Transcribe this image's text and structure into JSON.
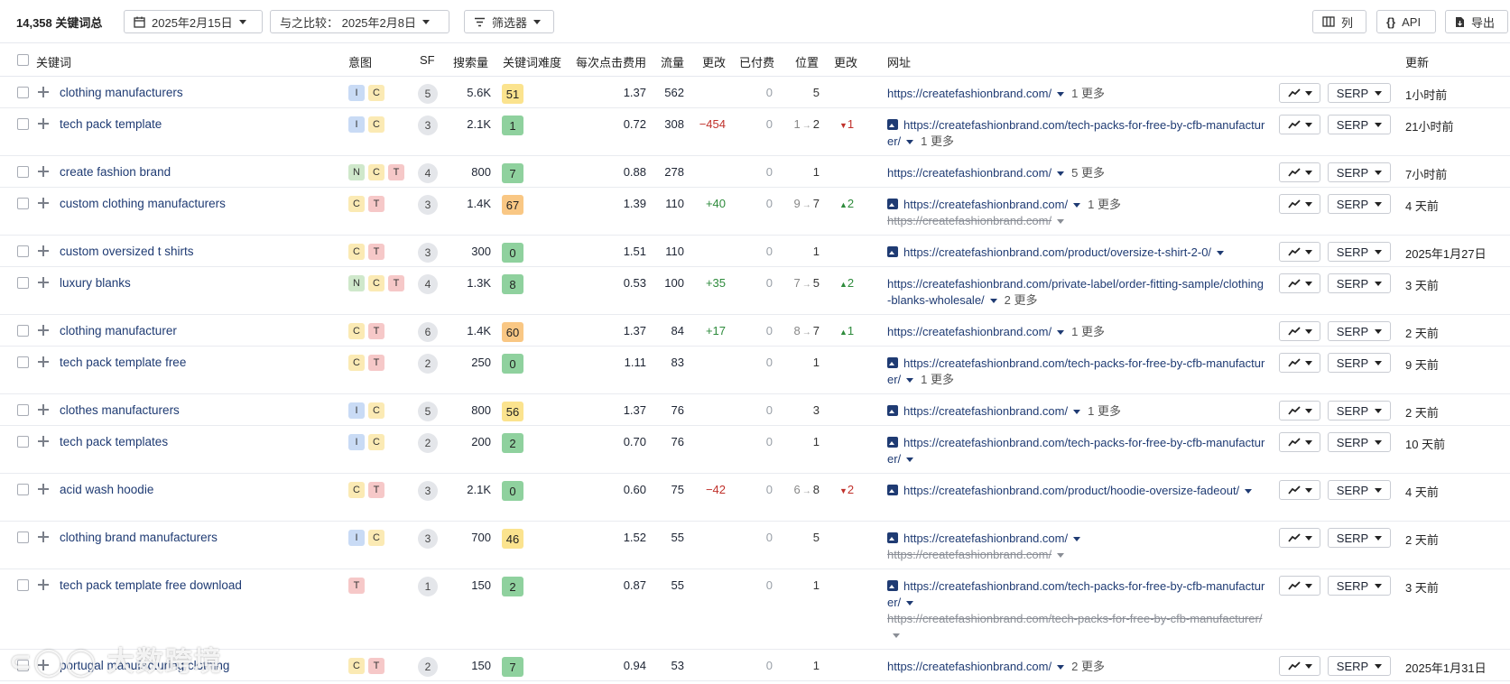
{
  "toolbar": {
    "count": "14,358 关键词总",
    "date": "2025年2月15日",
    "compare": "与之比较： 2025年2月8日",
    "filter": "筛选器",
    "columns": "列",
    "api": "API",
    "export": "导出"
  },
  "header": {
    "keyword": "关键词",
    "intent": "意图",
    "sf": "SF",
    "volume": "搜索量",
    "kd": "关键词难度",
    "cpc": "每次点击费用",
    "traffic": "流量",
    "change": "更改",
    "paid": "已付费",
    "position": "位置",
    "pos_change": "更改",
    "url": "网址",
    "updated": "更新"
  },
  "colors": {
    "kd_green": "#8fd19e",
    "kd_yellow": "#fbe38e",
    "kd_orange": "#f9c784",
    "positive": "#2e8b3c",
    "negative": "#c0312b"
  },
  "buttons": {
    "serp": "SERP"
  },
  "rows": [
    {
      "keyword": "clothing manufacturers",
      "intents": [
        "I",
        "C"
      ],
      "sf": "5",
      "volume": "5.6K",
      "kd": "51",
      "kd_color": "#fbe38e",
      "cpc": "1.37",
      "traffic": "562",
      "change": "",
      "paid": "0",
      "pos_from": "",
      "pos": "5",
      "pos_change": "",
      "pos_dir": "",
      "url_icon": false,
      "url": "https://createfashionbrand.com/",
      "more": "1 更多",
      "old_url": "",
      "updated": "1小时前"
    },
    {
      "keyword": "tech pack template",
      "intents": [
        "I",
        "C"
      ],
      "sf": "3",
      "volume": "2.1K",
      "kd": "1",
      "kd_color": "#8fd19e",
      "cpc": "0.72",
      "traffic": "308",
      "change": "−454",
      "paid": "0",
      "pos_from": "1",
      "pos": "2",
      "pos_change": "1",
      "pos_dir": "down",
      "url_icon": true,
      "url": "https://createfashionbrand.com/tech-packs-for-free-by-cfb-manufacturer/",
      "more": "1 更多",
      "old_url": "",
      "updated": "21小时前"
    },
    {
      "keyword": "create fashion brand",
      "intents": [
        "N",
        "C",
        "T"
      ],
      "sf": "4",
      "volume": "800",
      "kd": "7",
      "kd_color": "#8fd19e",
      "cpc": "0.88",
      "traffic": "278",
      "change": "",
      "paid": "0",
      "pos_from": "",
      "pos": "1",
      "pos_change": "",
      "pos_dir": "",
      "url_icon": false,
      "url": "https://createfashionbrand.com/",
      "more": "5 更多",
      "old_url": "",
      "updated": "7小时前"
    },
    {
      "keyword": "custom clothing manufacturers",
      "intents": [
        "C",
        "T"
      ],
      "sf": "3",
      "volume": "1.4K",
      "kd": "67",
      "kd_color": "#f9c784",
      "cpc": "1.39",
      "traffic": "110",
      "change": "+40",
      "paid": "0",
      "pos_from": "9",
      "pos": "7",
      "pos_change": "2",
      "pos_dir": "up",
      "url_icon": true,
      "url": "https://createfashionbrand.com/",
      "more": "1 更多",
      "old_url": "https://createfashionbrand.com/",
      "updated": "4 天前"
    },
    {
      "keyword": "custom oversized t shirts",
      "intents": [
        "C",
        "T"
      ],
      "sf": "3",
      "volume": "300",
      "kd": "0",
      "kd_color": "#8fd19e",
      "cpc": "1.51",
      "traffic": "110",
      "change": "",
      "paid": "0",
      "pos_from": "",
      "pos": "1",
      "pos_change": "",
      "pos_dir": "",
      "url_icon": true,
      "url": "https://createfashionbrand.com/product/oversize-t-shirt-2-0/",
      "more": "",
      "old_url": "",
      "updated": "2025年1月27日"
    },
    {
      "keyword": "luxury blanks",
      "intents": [
        "N",
        "C",
        "T"
      ],
      "sf": "4",
      "volume": "1.3K",
      "kd": "8",
      "kd_color": "#8fd19e",
      "cpc": "0.53",
      "traffic": "100",
      "change": "+35",
      "paid": "0",
      "pos_from": "7",
      "pos": "5",
      "pos_change": "2",
      "pos_dir": "up",
      "url_icon": false,
      "url": "https://createfashionbrand.com/private-label/order-fitting-sample/clothing-blanks-wholesale/",
      "more": "2 更多",
      "old_url": "",
      "updated": "3 天前"
    },
    {
      "keyword": "clothing manufacturer",
      "intents": [
        "C",
        "T"
      ],
      "sf": "6",
      "volume": "1.4K",
      "kd": "60",
      "kd_color": "#f9c784",
      "cpc": "1.37",
      "traffic": "84",
      "change": "+17",
      "paid": "0",
      "pos_from": "8",
      "pos": "7",
      "pos_change": "1",
      "pos_dir": "up",
      "url_icon": false,
      "url": "https://createfashionbrand.com/",
      "more": "1 更多",
      "old_url": "",
      "updated": "2 天前"
    },
    {
      "keyword": "tech pack template free",
      "intents": [
        "C",
        "T"
      ],
      "sf": "2",
      "volume": "250",
      "kd": "0",
      "kd_color": "#8fd19e",
      "cpc": "1.11",
      "traffic": "83",
      "change": "",
      "paid": "0",
      "pos_from": "",
      "pos": "1",
      "pos_change": "",
      "pos_dir": "",
      "url_icon": true,
      "url": "https://createfashionbrand.com/tech-packs-for-free-by-cfb-manufacturer/",
      "more": "1 更多",
      "old_url": "",
      "updated": "9 天前"
    },
    {
      "keyword": "clothes manufacturers",
      "intents": [
        "I",
        "C"
      ],
      "sf": "5",
      "volume": "800",
      "kd": "56",
      "kd_color": "#fbe38e",
      "cpc": "1.37",
      "traffic": "76",
      "change": "",
      "paid": "0",
      "pos_from": "",
      "pos": "3",
      "pos_change": "",
      "pos_dir": "",
      "url_icon": true,
      "url": "https://createfashionbrand.com/",
      "more": "1 更多",
      "old_url": "",
      "updated": "2 天前"
    },
    {
      "keyword": "tech pack templates",
      "intents": [
        "I",
        "C"
      ],
      "sf": "2",
      "volume": "200",
      "kd": "2",
      "kd_color": "#8fd19e",
      "cpc": "0.70",
      "traffic": "76",
      "change": "",
      "paid": "0",
      "pos_from": "",
      "pos": "1",
      "pos_change": "",
      "pos_dir": "",
      "url_icon": true,
      "url": "https://createfashionbrand.com/tech-packs-for-free-by-cfb-manufacturer/",
      "more": "",
      "old_url": "",
      "updated": "10 天前"
    },
    {
      "keyword": "acid wash hoodie",
      "intents": [
        "C",
        "T"
      ],
      "sf": "3",
      "volume": "2.1K",
      "kd": "0",
      "kd_color": "#8fd19e",
      "cpc": "0.60",
      "traffic": "75",
      "change": "−42",
      "paid": "0",
      "pos_from": "6",
      "pos": "8",
      "pos_change": "2",
      "pos_dir": "down",
      "url_icon": true,
      "url": "https://createfashionbrand.com/product/hoodie-oversize-fadeout/",
      "more": "",
      "old_url": "",
      "updated": "4 天前"
    },
    {
      "keyword": "clothing brand manufacturers",
      "intents": [
        "I",
        "C"
      ],
      "sf": "3",
      "volume": "700",
      "kd": "46",
      "kd_color": "#fbe38e",
      "cpc": "1.52",
      "traffic": "55",
      "change": "",
      "paid": "0",
      "pos_from": "",
      "pos": "5",
      "pos_change": "",
      "pos_dir": "",
      "url_icon": true,
      "url": "https://createfashionbrand.com/",
      "more": "",
      "old_url": "https://createfashionbrand.com/",
      "updated": "2 天前"
    },
    {
      "keyword": "tech pack template free download",
      "intents": [
        "T"
      ],
      "sf": "1",
      "volume": "150",
      "kd": "2",
      "kd_color": "#8fd19e",
      "cpc": "0.87",
      "traffic": "55",
      "change": "",
      "paid": "0",
      "pos_from": "",
      "pos": "1",
      "pos_change": "",
      "pos_dir": "",
      "url_icon": true,
      "url": "https://createfashionbrand.com/tech-packs-for-free-by-cfb-manufacturer/",
      "more": "",
      "old_url": "https://createfashionbrand.com/tech-packs-for-free-by-cfb-manufacturer/",
      "updated": "3 天前"
    },
    {
      "keyword": "portugal manufacturing clothing",
      "intents": [
        "C",
        "T"
      ],
      "sf": "2",
      "volume": "150",
      "kd": "7",
      "kd_color": "#8fd19e",
      "cpc": "0.94",
      "traffic": "53",
      "change": "",
      "paid": "0",
      "pos_from": "",
      "pos": "1",
      "pos_change": "",
      "pos_dir": "",
      "url_icon": false,
      "url": "https://createfashionbrand.com/",
      "more": "2 更多",
      "old_url": "",
      "updated": "2025年1月31日"
    }
  ],
  "watermark": "大数跨境"
}
